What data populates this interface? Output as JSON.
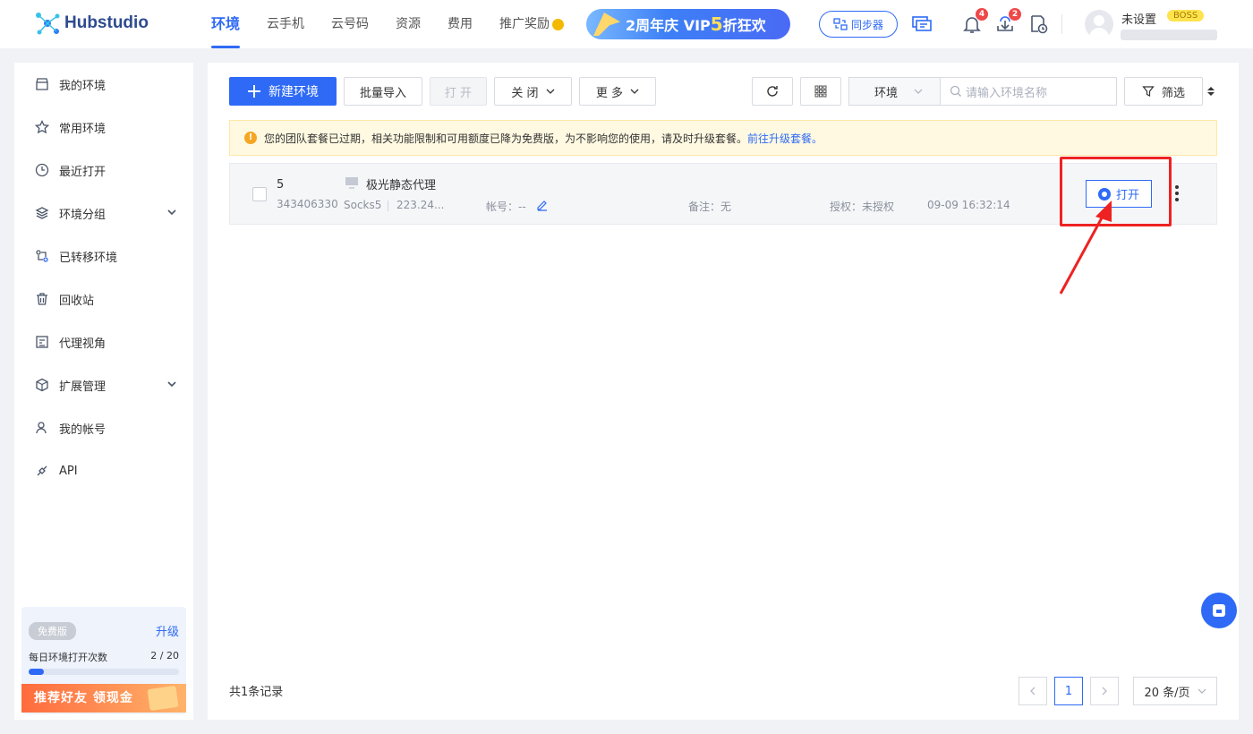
{
  "header": {
    "logo": "Hubstudio",
    "nav": [
      "环境",
      "云手机",
      "云号码",
      "资源",
      "费用",
      "推广奖励"
    ],
    "promo_prefix": "2周年庆 VIP",
    "promo_five": "5",
    "promo_suffix": "折狂欢",
    "sync_label": "同步器",
    "notification_count": "4",
    "download_count": "2",
    "user_name": "未设置",
    "user_role": "BOSS"
  },
  "sidebar": {
    "items": [
      {
        "label": "我的环境",
        "icon": "store-icon"
      },
      {
        "label": "常用环境",
        "icon": "star-icon"
      },
      {
        "label": "最近打开",
        "icon": "clock-icon"
      },
      {
        "label": "环境分组",
        "icon": "layers-icon",
        "expandable": true
      },
      {
        "label": "已转移环境",
        "icon": "transfer-icon"
      },
      {
        "label": "回收站",
        "icon": "trash-icon"
      },
      {
        "label": "代理视角",
        "icon": "proxy-view-icon"
      },
      {
        "label": "扩展管理",
        "icon": "cube-icon",
        "expandable": true
      },
      {
        "label": "我的帐号",
        "icon": "user-icon"
      },
      {
        "label": "API",
        "icon": "api-icon"
      }
    ],
    "plan": {
      "badge": "免费版",
      "upgrade": "升级",
      "label": "每日环境打开次数",
      "count": "2 / 20",
      "progress_fraction": 0.1,
      "referral": "推荐好友 领现金"
    }
  },
  "toolbar": {
    "new_env": "新建环境",
    "batch_import": "批量导入",
    "open": "打 开",
    "close": "关 闭",
    "more": "更 多",
    "search_scope": "环境",
    "search_placeholder": "请输入环境名称",
    "filter": "筛选"
  },
  "notice": {
    "text": "您的团队套餐已过期，相关功能限制和可用额度已降为免费版，为不影响您的使用，请及时升级套餐。",
    "link": "前往升级套餐。"
  },
  "table": {
    "rows": [
      {
        "index": "5",
        "id": "343406330",
        "name": "极光静态代理",
        "proxy_type": "Socks5",
        "proxy_ip": "223.24...",
        "account": "帐号：--",
        "remark": "备注：无",
        "auth": "授权：未授权",
        "time": "09-09 16:32:14",
        "open_label": "打开"
      }
    ]
  },
  "footer": {
    "total": "共1条记录",
    "current_page": "1",
    "page_size": "20 条/页"
  },
  "colors": {
    "accent": "#2e6af6",
    "highlight": "#ee2222",
    "notice_bg": "#fff9e1"
  }
}
